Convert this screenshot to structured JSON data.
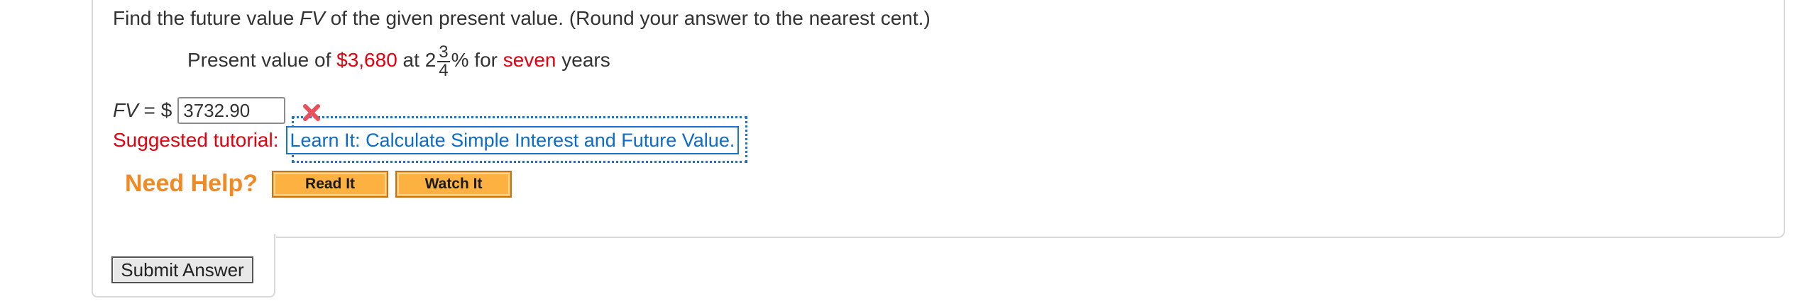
{
  "question": {
    "text_before": "Find the future value ",
    "fv_symbol": "FV",
    "text_after": " of the given present value. (Round your answer to the nearest cent.)"
  },
  "present_value_line": {
    "prefix": "Present value of ",
    "amount": "$3,680",
    "at": " at ",
    "rate_whole": "2",
    "rate_numerator": "3",
    "rate_denominator": "4",
    "rate_suffix": "%",
    "for": " for ",
    "duration": "seven",
    "unit": " years"
  },
  "answer": {
    "label_fv": "FV",
    "label_equals": " = $",
    "value": "3732.90",
    "status": "incorrect"
  },
  "tutorial": {
    "label": "Suggested tutorial:",
    "link_text": "Learn It: Calculate Simple Interest and Future Value."
  },
  "help": {
    "label": "Need Help?",
    "read_label": "Read It",
    "watch_label": "Watch It"
  },
  "submit": {
    "label": "Submit Answer"
  },
  "colors": {
    "highlight_red": "#e3000f",
    "link_blue": "#0a6ccc",
    "help_orange": "#f08a24",
    "button_orange": "#fcb141"
  },
  "icons": {
    "answer_status": "wrong-x-icon"
  }
}
